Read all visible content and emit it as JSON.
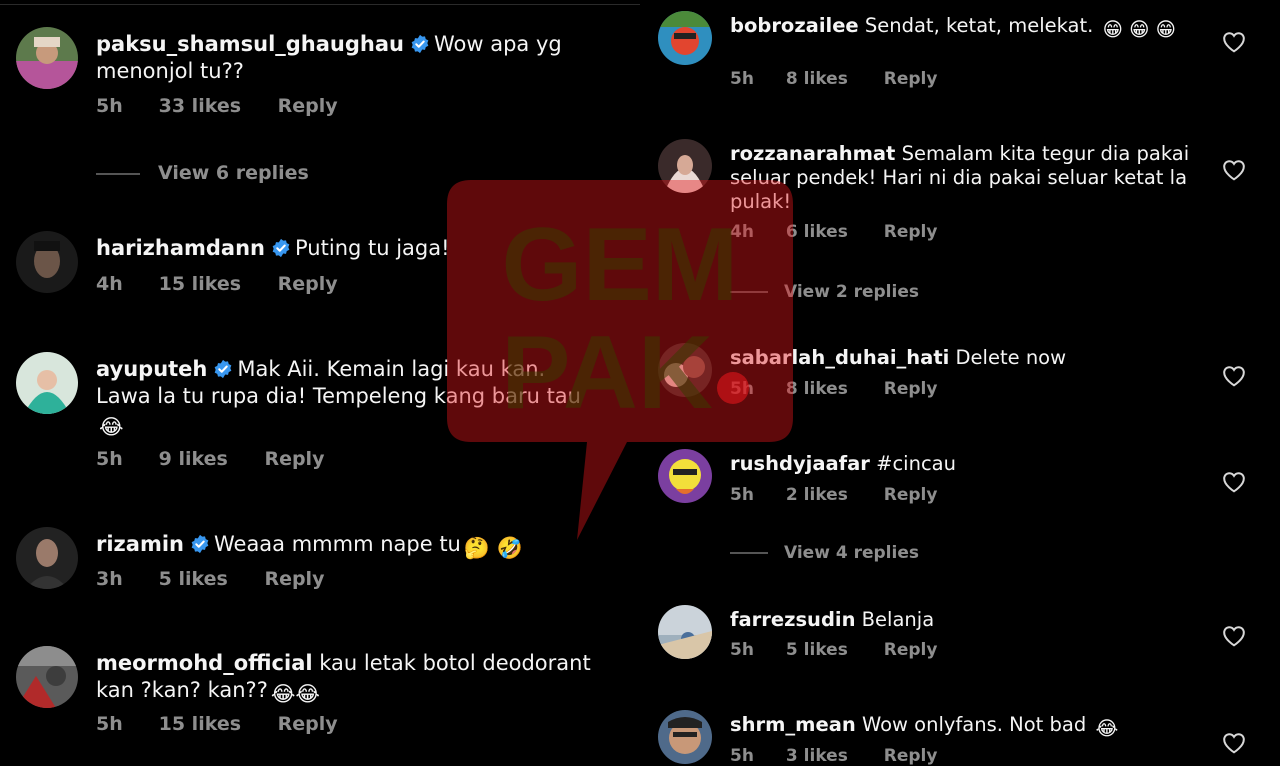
{
  "colors": {
    "background": "#000000",
    "text": "#f5f5f5",
    "muted": "#8e8e8e",
    "verified": "#3897f0",
    "watermark": "#e3151a"
  },
  "watermark": {
    "line1": "GEM",
    "line2": "PAK"
  },
  "left_comments": [
    {
      "username": "paksu_shamsul_ghaughau",
      "verified": true,
      "text": "Wow apa yg menonjol tu??",
      "time": "5h",
      "likes": "33 likes",
      "reply": "Reply",
      "view_replies": "View 6 replies"
    },
    {
      "username": "harizhamdann",
      "verified": true,
      "text": "Puting tu jaga!",
      "time": "4h",
      "likes": "15 likes",
      "reply": "Reply"
    },
    {
      "username": "ayuputeh",
      "verified": true,
      "text": "Mak Aii. Kemain lagi kau kan. Lawa la tu rupa dia! Tempeleng kang baru tau",
      "emoji": "😂",
      "time": "5h",
      "likes": "9 likes",
      "reply": "Reply"
    },
    {
      "username": "rizamin",
      "verified": true,
      "text": "Weaaa mmmm nape tu",
      "emoji": "🤔 🤣",
      "time": "3h",
      "likes": "5 likes",
      "reply": "Reply"
    },
    {
      "username": "meormohd_official",
      "verified": false,
      "text": "kau letak botol deodorant kan ?kan? kan??",
      "emoji": "😂😂",
      "time": "5h",
      "likes": "15 likes",
      "reply": "Reply"
    }
  ],
  "right_comments": [
    {
      "username": "bobrozailee",
      "text": "Sendat, ketat, melekat.",
      "emoji": "😁 😁 😁",
      "time": "5h",
      "likes": "8 likes",
      "reply": "Reply"
    },
    {
      "username": "rozzanarahmat",
      "text": "Semalam kita tegur dia pakai seluar pendek! Hari ni dia pakai seluar ketat la pulak!",
      "time": "4h",
      "likes": "6 likes",
      "reply": "Reply",
      "view_replies": "View 2 replies"
    },
    {
      "username": "sabarlah_duhai_hati",
      "text": "Delete now",
      "time": "5h",
      "likes": "8 likes",
      "reply": "Reply"
    },
    {
      "username": "rushdyjaafar",
      "text": "#cincau",
      "time": "5h",
      "likes": "2 likes",
      "reply": "Reply",
      "view_replies": "View 4 replies"
    },
    {
      "username": "farrezsudin",
      "text": "Belanja",
      "time": "5h",
      "likes": "5 likes",
      "reply": "Reply"
    },
    {
      "username": "shrm_mean",
      "text": "Wow onlyfans. Not bad",
      "emoji": "😂",
      "time": "5h",
      "likes": "3 likes",
      "reply": "Reply"
    }
  ]
}
